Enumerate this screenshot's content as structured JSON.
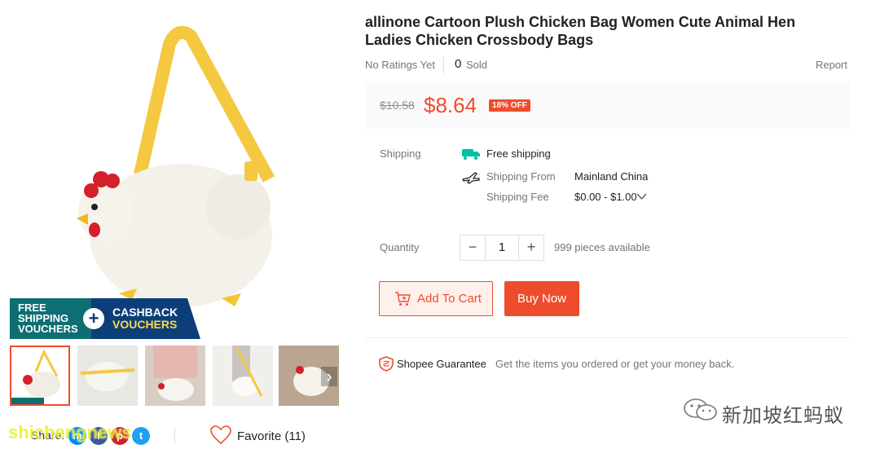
{
  "product": {
    "title": "allinone Cartoon Plush Chicken Bag Women Cute Animal Hen Ladies Chicken Crossbody Bags",
    "ratings": "No Ratings Yet",
    "sold_count": "0",
    "sold_label": "Sold",
    "report": "Report"
  },
  "price": {
    "original": "$10.58",
    "current": "$8.64",
    "discount": "18% OFF"
  },
  "shipping": {
    "label": "Shipping",
    "free": "Free shipping",
    "from_label": "Shipping From",
    "from_value": "Mainland China",
    "fee_label": "Shipping Fee",
    "fee_value": "$0.00 - $1.00"
  },
  "quantity": {
    "label": "Quantity",
    "value": "1",
    "available": "999 pieces available",
    "minus": "−",
    "plus": "+"
  },
  "actions": {
    "add_to_cart": "Add To Cart",
    "buy_now": "Buy Now"
  },
  "guarantee": {
    "title": "Shopee Guarantee",
    "text": "Get the items you ordered or get your money back."
  },
  "promo": {
    "line1": "FREE",
    "line2": "SHIPPING",
    "line3": "VOUCHERS",
    "plus": "+",
    "cashback1": "CASHBACK",
    "cashback2": "VOUCHERS"
  },
  "share": {
    "label": "Share:",
    "icons": [
      "messenger-icon",
      "facebook-icon",
      "pinterest-icon",
      "twitter-icon"
    ]
  },
  "favorite": {
    "label": "Favorite (11)"
  },
  "watermarks": {
    "left": "shichengnews",
    "right": "新加坡红蚂蚁"
  },
  "colors": {
    "accent": "#ee4d2d",
    "teal": "#0d6e73",
    "navy": "#0c3f79",
    "strap": "#f5c842"
  }
}
